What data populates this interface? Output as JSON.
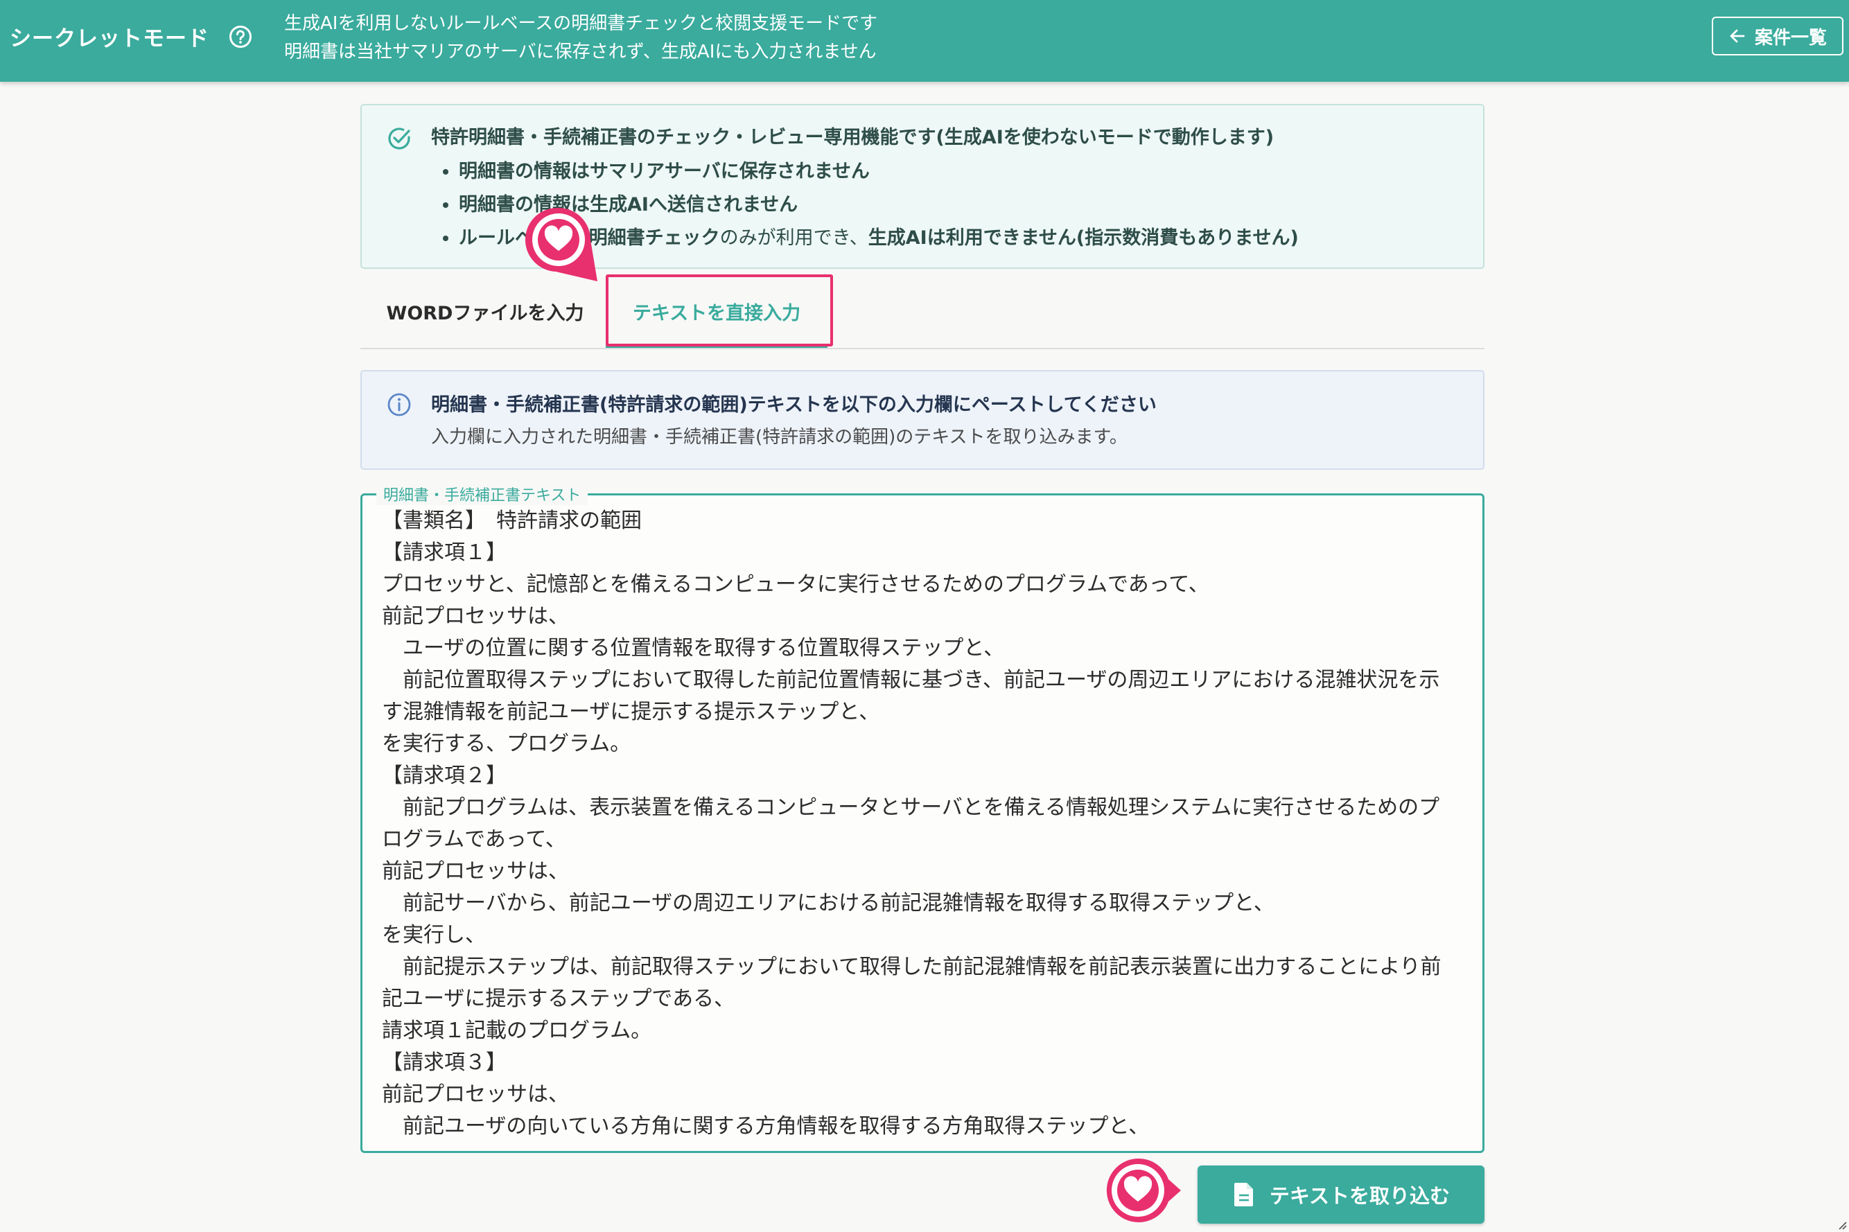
{
  "header": {
    "title": "シークレットモード",
    "description_line1": "生成AIを利用しないルールベースの明細書チェックと校閲支援モードです",
    "description_line2": "明細書は当社サマリアのサーバに保存されず、生成AIにも入力されません",
    "back_label": "案件一覧",
    "bg_color": "#3aab9d"
  },
  "notice": {
    "title": "特許明細書・手続補正書のチェック・レビュー専用機能です(生成AIを使わないモードで動作します)",
    "bullet1": "明細書の情報はサマリアサーバに保存されません",
    "bullet2": "明細書の情報は生成AIへ送信されません",
    "bullet3_part1": "ルールベースの明細書チェック",
    "bullet3_part2": "のみが利用でき、",
    "bullet3_part3": "生成AIは利用できません(指示数消費もありません)"
  },
  "tabs": {
    "word_label": "WORDファイルを入力",
    "text_label": "テキストを直接入力",
    "active": "text"
  },
  "info": {
    "title": "明細書・手続補正書(特許請求の範囲)テキストを以下の入力欄にペーストしてください",
    "description": "入力欄に入力された明細書・手続補正書(特許請求の範囲)のテキストを取り込みます。"
  },
  "textarea": {
    "legend": "明細書・手続補正書テキスト",
    "value": "【書類名】　特許請求の範囲\n【請求項１】\nプロセッサと、記憶部とを備えるコンピュータに実行させるためのプログラムであって、\n前記プロセッサは、\n　ユーザの位置に関する位置情報を取得する位置取得ステップと、\n　前記位置取得ステップにおいて取得した前記位置情報に基づき、前記ユーザの周辺エリアにおける混雑状況を示す混雑情報を前記ユーザに提示する提示ステップと、\nを実行する、プログラム。\n【請求項２】\n　前記プログラムは、表示装置を備えるコンピュータとサーバとを備える情報処理システムに実行させるためのプログラムであって、\n前記プロセッサは、\n　前記サーバから、前記ユーザの周辺エリアにおける前記混雑情報を取得する取得ステップと、\nを実行し、\n　前記提示ステップは、前記取得ステップにおいて取得した前記混雑情報を前記表示装置に出力することにより前記ユーザに提示するステップである、\n請求項１記載のプログラム。\n【請求項３】\n前記プロセッサは、\n　前記ユーザの向いている方角に関する方角情報を取得する方角取得ステップと、"
  },
  "import_button": {
    "label": "テキストを取り込む"
  },
  "icons": {
    "help": "help-circle-icon",
    "back": "arrow-left-icon",
    "check": "check-circle-icon",
    "info": "info-circle-icon",
    "document": "document-icon",
    "marker": "heart-pointer-icon"
  },
  "colors": {
    "accent": "#3aab9d",
    "highlight": "#e8306e"
  }
}
